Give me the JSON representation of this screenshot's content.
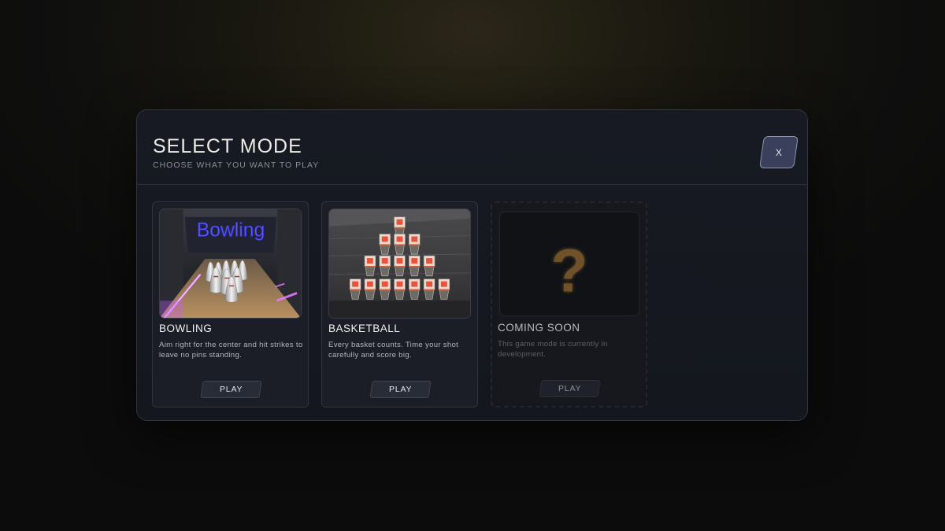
{
  "modal": {
    "title": "SELECT MODE",
    "subtitle": "CHOOSE WHAT YOU WANT TO PLAY",
    "close_label": "X"
  },
  "modes": [
    {
      "name": "BOWLING",
      "description": "Aim right for the center and hit strikes to leave no pins standing.",
      "play_label": "PLAY",
      "thumbnail_sign": "Bowling"
    },
    {
      "name": "BASKETBALL",
      "description": "Every basket counts. Time your shot carefully and score big.",
      "play_label": "PLAY"
    },
    {
      "name": "COMING SOON",
      "description": "This game mode is currently in development.",
      "play_label": "PLAY",
      "thumbnail_glyph": "?"
    }
  ],
  "colors": {
    "accent_close": "#3a3f5c",
    "neon_sign": "#4b47ff",
    "neon_lane": "#c65cff",
    "mystery_glyph": "#7a5a2a"
  }
}
